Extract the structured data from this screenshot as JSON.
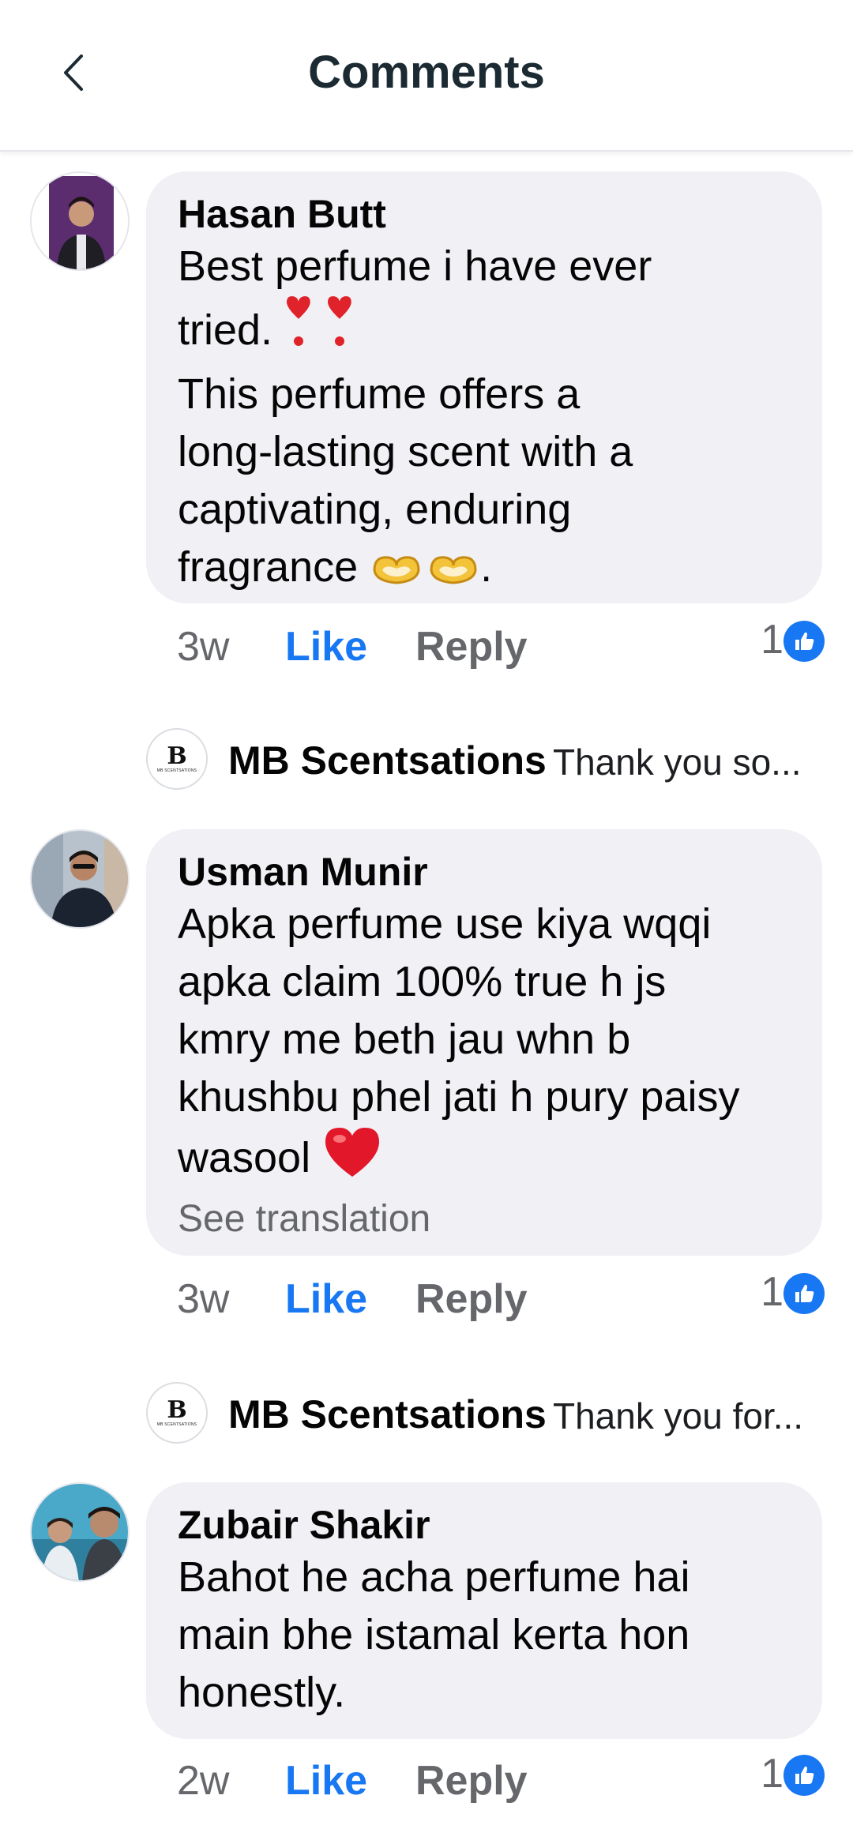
{
  "header": {
    "title": "Comments",
    "back_icon": "chevron-left-icon"
  },
  "colors": {
    "accent": "#1877f2",
    "bubble": "#f0f0f5",
    "secondary_text": "#65676b"
  },
  "comments": [
    {
      "author": "Hasan Butt",
      "text_line1": "Best perfume i have ever",
      "text_line2": "tried.",
      "text_line2_emoji": "heavy-heart-exclamation-icon x2",
      "text_rest": "This perfume offers a\nlong-lasting scent with a\ncaptivating, enduring",
      "text_last": "fragrance",
      "text_last_emoji": "heart-hands-icon x2",
      "text_last_suffix": ".",
      "time": "3w",
      "like_label": "Like",
      "reply_label": "Reply",
      "reaction_count": "1",
      "reply_preview": {
        "author": "MB Scentsations",
        "snippet": "Thank you so...",
        "logo_mark": "B",
        "logo_text": "MB SCENTSATIONS"
      }
    },
    {
      "author": "Usman Munir",
      "text": "Apka perfume use kiya wqqi\napka claim 100% true h js\nkmry me beth jau whn b\nkhushbu phel jati h pury paisy",
      "text_last": "wasool",
      "text_last_emoji": "red-heart-icon",
      "see_translation": "See translation",
      "time": "3w",
      "like_label": "Like",
      "reply_label": "Reply",
      "reaction_count": "1",
      "reply_preview": {
        "author": "MB Scentsations",
        "snippet": "Thank you for...",
        "logo_mark": "B",
        "logo_text": "MB SCENTSATIONS"
      }
    },
    {
      "author": "Zubair Shakir",
      "text": "Bahot he acha perfume hai\nmain bhe istamal kerta hon\nhonestly.",
      "time": "2w",
      "like_label": "Like",
      "reply_label": "Reply",
      "reaction_count": "1"
    }
  ]
}
